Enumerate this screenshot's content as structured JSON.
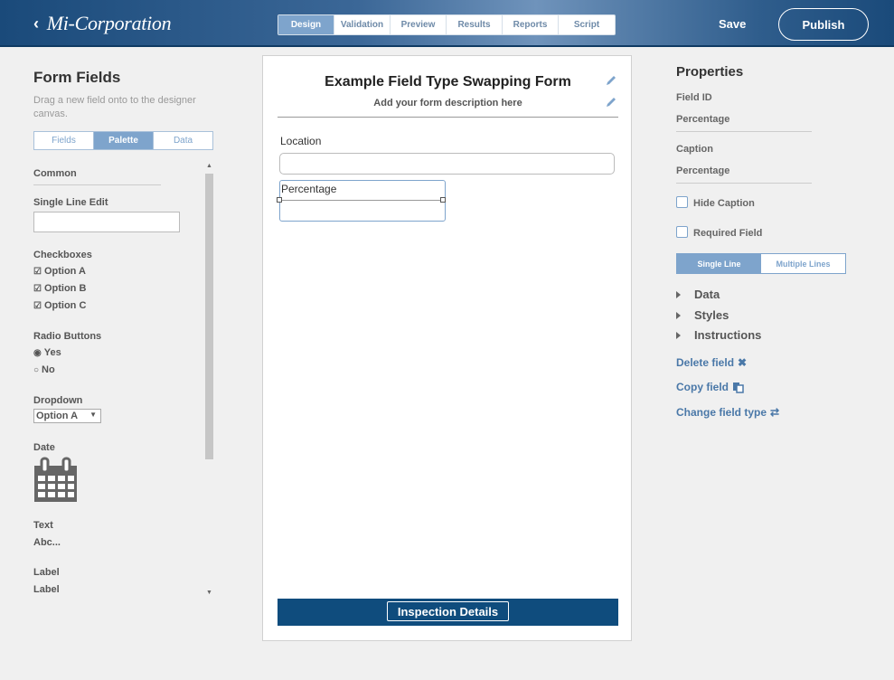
{
  "header": {
    "brand": "Mi-Corporation",
    "tabs": [
      {
        "label": "Design",
        "active": true
      },
      {
        "label": "Validation"
      },
      {
        "label": "Preview"
      },
      {
        "label": "Results"
      },
      {
        "label": "Reports"
      },
      {
        "label": "Script"
      }
    ],
    "save_label": "Save",
    "publish_label": "Publish"
  },
  "left_panel": {
    "title": "Form Fields",
    "description": "Drag a new field onto to the designer canvas.",
    "subtabs": [
      "Fields",
      "Palette",
      "Data"
    ],
    "active_subtab": "Palette",
    "palette": {
      "common": "Common",
      "single_line_edit": "Single Line Edit",
      "checkboxes": "Checkboxes",
      "checkbox_options": [
        "Option A",
        "Option B",
        "Option C"
      ],
      "radio_buttons": "Radio Buttons",
      "radio_options": [
        "Yes",
        "No"
      ],
      "dropdown": "Dropdown",
      "dropdown_value": "Option A",
      "date": "Date",
      "text": "Text",
      "text_value": "Abc...",
      "label": "Label",
      "label_value": "Label"
    }
  },
  "canvas": {
    "form_title": "Example Field Type Swapping Form",
    "form_description": "Add your form description here",
    "fields": [
      {
        "caption": "Location"
      },
      {
        "caption": "Percentage",
        "selected": true
      }
    ],
    "footer_button": "Inspection Details"
  },
  "properties": {
    "title": "Properties",
    "field_id_label": "Field ID",
    "field_id_value": "Percentage",
    "caption_label": "Caption",
    "caption_value": "Percentage",
    "hide_caption": "Hide Caption",
    "required_field": "Required Field",
    "line_modes": [
      "Single Line",
      "Multiple Lines"
    ],
    "active_line_mode": "Single Line",
    "sections": [
      "Data",
      "Styles",
      "Instructions"
    ],
    "actions": {
      "delete": "Delete field",
      "copy": "Copy field",
      "change_type": "Change field type"
    }
  },
  "colors": {
    "accent": "#7ea4cc",
    "header_dark": "#1a4a7a",
    "footer_bar": "#0f4c7d",
    "link": "#4a78a8"
  }
}
